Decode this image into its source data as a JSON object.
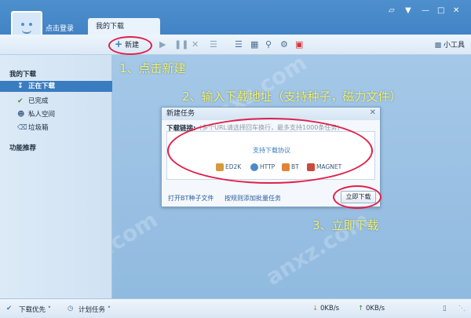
{
  "header": {
    "login_text": "点击登录",
    "tab_label": "我的下载"
  },
  "toolbar": {
    "new_label": "新建",
    "tools_label": "小工具"
  },
  "sidebar": {
    "section_download": "我的下载",
    "items": [
      {
        "label": "正在下载"
      },
      {
        "label": "已完成"
      },
      {
        "label": "私人空间"
      },
      {
        "label": "垃圾箱"
      }
    ],
    "section_recommend": "功能推荐"
  },
  "annotations": {
    "step1": "1、点击新建",
    "step2": "2、输入下载地址（支持种子，磁力文件）",
    "step3": "3、立即下载"
  },
  "dialog": {
    "title": "新建任务",
    "link_label": "下载链接:",
    "placeholder": "(多个URL请选择回车换行，最多支持1000条任务)",
    "protocol_title": "支持下载协议",
    "protocols": [
      "ED2K",
      "HTTP",
      "BT",
      "MAGNET"
    ],
    "open_bt": "打开BT种子文件",
    "batch": "按规则添加批量任务",
    "go_button": "立即下载"
  },
  "statusbar": {
    "priority": "下载优先",
    "plan": "计划任务",
    "down_speed": "0KB/s",
    "up_speed": "0KB/s"
  },
  "colors": {
    "accent": "#3a7cc0",
    "annotation_text": "#f7f06a",
    "annotation_ring": "#e0204a"
  }
}
